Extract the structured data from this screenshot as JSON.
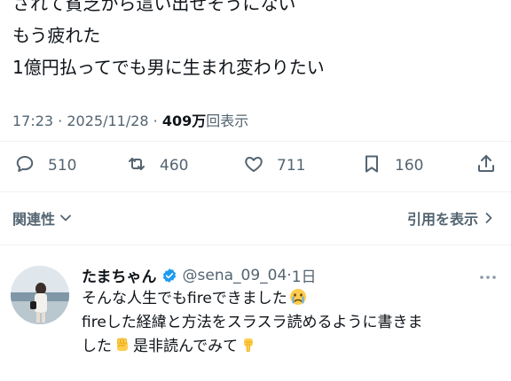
{
  "tweet": {
    "lines": [
      "されて貧乏から這い出せそうにない",
      "もう疲れた",
      "1億円払ってでも男に生まれ変わりたい"
    ],
    "time": "17:23 · 2025/11/28 · ",
    "views_count": "409万",
    "views_label": "回表示"
  },
  "actions": {
    "replies": "510",
    "reposts": "460",
    "likes": "711",
    "bookmarks": "160"
  },
  "sort": {
    "label": "関連性",
    "quotes_label": "引用を表示"
  },
  "reply": {
    "name": "たまちゃん",
    "handle": "@sena_09_04",
    "separator": "·",
    "time": "1日",
    "line1": "そんな人生でもfireできました",
    "line2": "fireした経緯と方法をスラスラ読めるように書きま",
    "line3a": "した",
    "line3b": "是非読んでみて"
  },
  "colors": {
    "text": "#0f1419",
    "secondary": "#536471",
    "verified": "#1d9bf0",
    "divider": "#eff3f4"
  },
  "icons": {
    "reply": "speech-bubble-icon",
    "repost": "repost-arrows-icon",
    "like": "heart-icon",
    "bookmark": "bookmark-icon",
    "share": "share-upload-icon",
    "verified": "verified-badge-icon",
    "more": "more-dots-icon"
  }
}
